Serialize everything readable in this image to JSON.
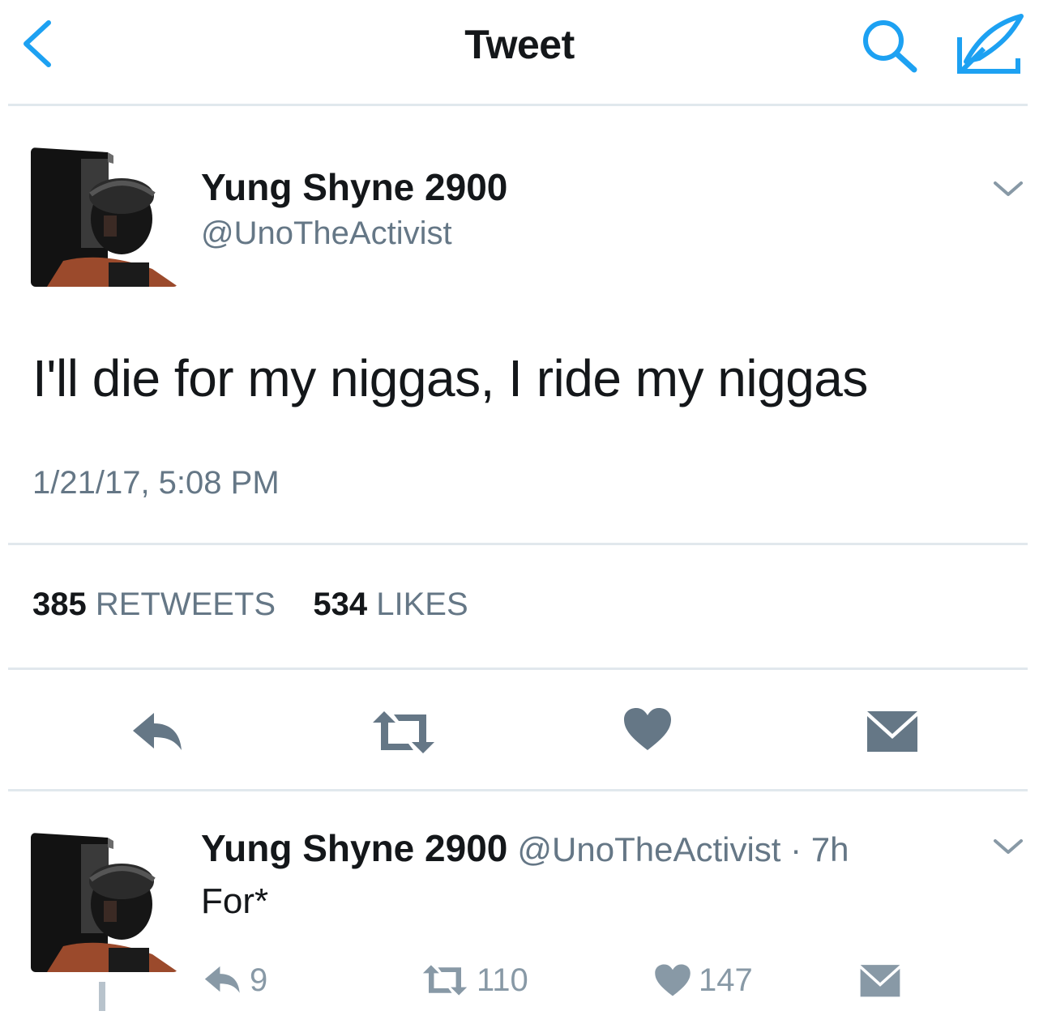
{
  "nav": {
    "title": "Tweet",
    "back_icon": "chevron-left-icon",
    "search_icon": "search-icon",
    "compose_icon": "compose-icon",
    "accent": "#1da1f2"
  },
  "tweet": {
    "author_name": "Yung Shyne 2900",
    "author_handle": "@UnoTheActivist",
    "text": "I'll die for my niggas, I ride my niggas",
    "timestamp": "1/21/17, 5:08 PM",
    "retweets": "385",
    "retweets_label": "RETWEETS",
    "likes": "534",
    "likes_label": "LIKES",
    "actions": [
      "reply-icon",
      "retweet-icon",
      "heart-icon",
      "direct-message-icon"
    ]
  },
  "reply": {
    "author_name": "Yung Shyne 2900",
    "meta": "@UnoTheActivist · 7h",
    "text": "For*",
    "reply_count": "9",
    "retweet_count": "110",
    "like_count": "147"
  },
  "colors": {
    "text": "#14171a",
    "secondary": "#657786",
    "icon": "#657786",
    "divider": "#e1e8ed"
  }
}
